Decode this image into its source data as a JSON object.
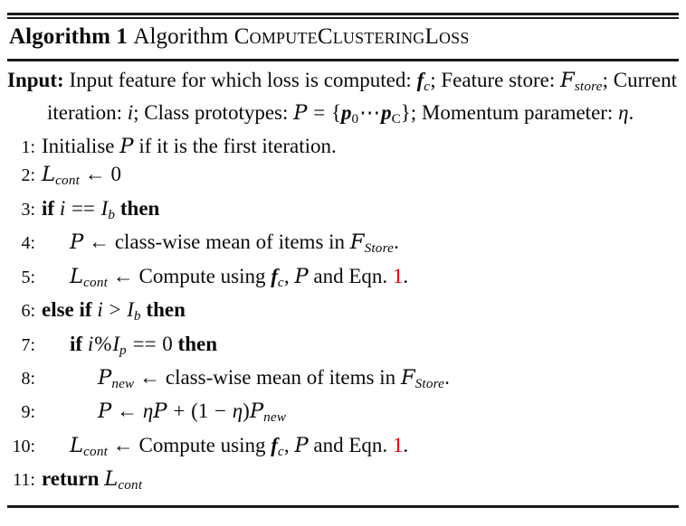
{
  "document": {
    "type": "latex-algorithm-environment",
    "accent_color": "#ee0000",
    "text_color": "#0b0b0b"
  },
  "caption": {
    "label_bold": "Algorithm 1",
    "word_algorithm": "Algorithm",
    "procedure_name": "ComputeClusteringLoss"
  },
  "input_block": {
    "keyword": "Input:",
    "text_part1": "Input feature for which loss is computed:",
    "symbol_fc_base": "f",
    "symbol_fc_sub": "c",
    "text_part2": "; Feature store:",
    "symbol_F_base": "F",
    "symbol_F_sub": "store",
    "text_part3": "; Current iteration:",
    "symbol_i": "i",
    "text_part4": "; Class prototypes:",
    "symbol_P": "P",
    "equals": "=",
    "set_open": "{",
    "proto_first_base": "p",
    "proto_first_sub": "0",
    "dots": "⋯",
    "proto_last_base": "p",
    "proto_last_sub": "C",
    "set_close": "}",
    "text_part5": "; Momentum parameter:",
    "symbol_eta": "η",
    "period": "."
  },
  "steps": [
    {
      "number": "1:",
      "indent": 0,
      "parts": [
        {
          "kind": "roman",
          "text": "Initialise "
        },
        {
          "kind": "cal",
          "text": "P"
        },
        {
          "kind": "roman",
          "text": " if it is the first iteration."
        }
      ]
    },
    {
      "number": "2:",
      "indent": 0,
      "parts": [
        {
          "kind": "cal",
          "text": "L"
        },
        {
          "kind": "sub",
          "text": "cont"
        },
        {
          "kind": "arrow",
          "text": " ← "
        },
        {
          "kind": "num",
          "text": "0"
        }
      ]
    },
    {
      "number": "3:",
      "indent": 0,
      "parts": [
        {
          "kind": "kw",
          "text": "if "
        },
        {
          "kind": "mathit",
          "text": "i"
        },
        {
          "kind": "op",
          "text": " == "
        },
        {
          "kind": "mathit",
          "text": "I"
        },
        {
          "kind": "sub",
          "text": "b"
        },
        {
          "kind": "kw",
          "text": " then"
        }
      ]
    },
    {
      "number": "4:",
      "indent": 1,
      "parts": [
        {
          "kind": "cal",
          "text": "P"
        },
        {
          "kind": "arrow",
          "text": " ← "
        },
        {
          "kind": "roman",
          "text": "class-wise mean of items in "
        },
        {
          "kind": "cal",
          "text": "F"
        },
        {
          "kind": "sub",
          "text": "Store"
        },
        {
          "kind": "roman",
          "text": "."
        }
      ]
    },
    {
      "number": "5:",
      "indent": 1,
      "parts": [
        {
          "kind": "cal",
          "text": "L"
        },
        {
          "kind": "sub",
          "text": "cont"
        },
        {
          "kind": "arrow",
          "text": " ← "
        },
        {
          "kind": "roman",
          "text": "Compute using "
        },
        {
          "kind": "bfit",
          "text": "f"
        },
        {
          "kind": "sub",
          "text": "c"
        },
        {
          "kind": "roman",
          "text": ", "
        },
        {
          "kind": "cal",
          "text": "P"
        },
        {
          "kind": "roman",
          "text": " and Eqn. "
        },
        {
          "kind": "ref",
          "text": "1"
        },
        {
          "kind": "roman",
          "text": "."
        }
      ]
    },
    {
      "number": "6:",
      "indent": 0,
      "parts": [
        {
          "kind": "kw",
          "text": "else if "
        },
        {
          "kind": "mathit",
          "text": "i"
        },
        {
          "kind": "op",
          "text": " > "
        },
        {
          "kind": "mathit",
          "text": "I"
        },
        {
          "kind": "sub",
          "text": "b"
        },
        {
          "kind": "kw",
          "text": " then"
        }
      ]
    },
    {
      "number": "7:",
      "indent": 1,
      "parts": [
        {
          "kind": "kw",
          "text": "if "
        },
        {
          "kind": "mathit",
          "text": "i"
        },
        {
          "kind": "op",
          "text": "%"
        },
        {
          "kind": "mathit",
          "text": "I"
        },
        {
          "kind": "sub",
          "text": "p"
        },
        {
          "kind": "op",
          "text": " == "
        },
        {
          "kind": "num",
          "text": "0"
        },
        {
          "kind": "kw",
          "text": " then"
        }
      ]
    },
    {
      "number": "8:",
      "indent": 2,
      "parts": [
        {
          "kind": "cal",
          "text": "P"
        },
        {
          "kind": "sub",
          "text": "new"
        },
        {
          "kind": "arrow",
          "text": " ← "
        },
        {
          "kind": "roman",
          "text": "class-wise mean of items in "
        },
        {
          "kind": "cal",
          "text": "F"
        },
        {
          "kind": "sub",
          "text": "Store"
        },
        {
          "kind": "roman",
          "text": "."
        }
      ]
    },
    {
      "number": "9:",
      "indent": 2,
      "parts": [
        {
          "kind": "cal",
          "text": "P"
        },
        {
          "kind": "arrow",
          "text": " ← "
        },
        {
          "kind": "mathit",
          "text": "η"
        },
        {
          "kind": "cal",
          "text": "P"
        },
        {
          "kind": "op",
          "text": " + "
        },
        {
          "kind": "num",
          "text": "(1 "
        },
        {
          "kind": "op",
          "text": "−"
        },
        {
          "kind": "num",
          "text": " "
        },
        {
          "kind": "mathit",
          "text": "η"
        },
        {
          "kind": "num",
          "text": ")"
        },
        {
          "kind": "cal",
          "text": "P"
        },
        {
          "kind": "sub",
          "text": "new"
        }
      ]
    },
    {
      "number": "10:",
      "indent": 1,
      "parts": [
        {
          "kind": "cal",
          "text": "L"
        },
        {
          "kind": "sub",
          "text": "cont"
        },
        {
          "kind": "arrow",
          "text": " ← "
        },
        {
          "kind": "roman",
          "text": "Compute using "
        },
        {
          "kind": "bfit",
          "text": "f"
        },
        {
          "kind": "sub",
          "text": "c"
        },
        {
          "kind": "roman",
          "text": ", "
        },
        {
          "kind": "cal",
          "text": "P"
        },
        {
          "kind": "roman",
          "text": " and Eqn. "
        },
        {
          "kind": "ref",
          "text": "1"
        },
        {
          "kind": "roman",
          "text": "."
        }
      ]
    },
    {
      "number": "11:",
      "indent": 0,
      "parts": [
        {
          "kind": "kw",
          "text": "return "
        },
        {
          "kind": "cal",
          "text": "L"
        },
        {
          "kind": "sub",
          "text": "cont"
        }
      ]
    }
  ]
}
